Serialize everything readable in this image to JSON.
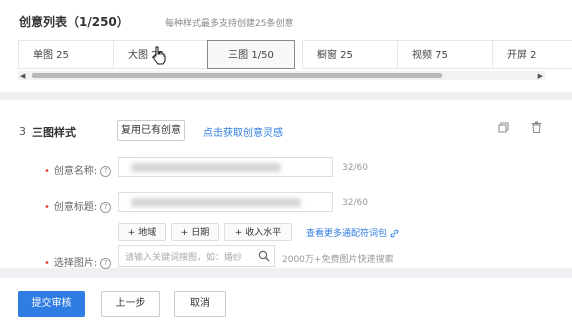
{
  "creative_list": {
    "title": "创意列表（1/250）",
    "hint": "每种样式最多支持创建25条创意"
  },
  "tabs": [
    {
      "label": "单图 25"
    },
    {
      "label": "大图 25"
    },
    {
      "label": "三图 1/50"
    },
    {
      "label": "橱窗 25"
    },
    {
      "label": "视频 75"
    },
    {
      "label": "开屏 2"
    }
  ],
  "scrollbar": {
    "left_arrow": "◀",
    "right_arrow": "▶"
  },
  "section": {
    "number": "3",
    "title": "三图样式",
    "reuse_button": "复用已有创意",
    "inspire_link": "点击获取创意灵感",
    "copy_icon": "copy-icon",
    "delete_icon": "trash-icon"
  },
  "fields": {
    "name_label": "创意名称:",
    "name_counter": "32/60",
    "headline_label": "创意标题:",
    "headline_counter": "32/60",
    "image_label": "选择图片:",
    "help_glyph": "?",
    "required_mark": "•"
  },
  "wildcards": {
    "region": "+ 地域",
    "date": "+ 日期",
    "income": "+ 收入水平",
    "more_link": "查看更多通配符词包"
  },
  "image_search": {
    "placeholder": "请输入关键词搜图，如：婚纱",
    "note": "2000万+免费图片快速搜索"
  },
  "footer": {
    "submit": "提交审核",
    "prev": "上一步",
    "cancel": "取消"
  },
  "colors": {
    "accent": "#2f7de1",
    "required": "#e64c3c"
  }
}
